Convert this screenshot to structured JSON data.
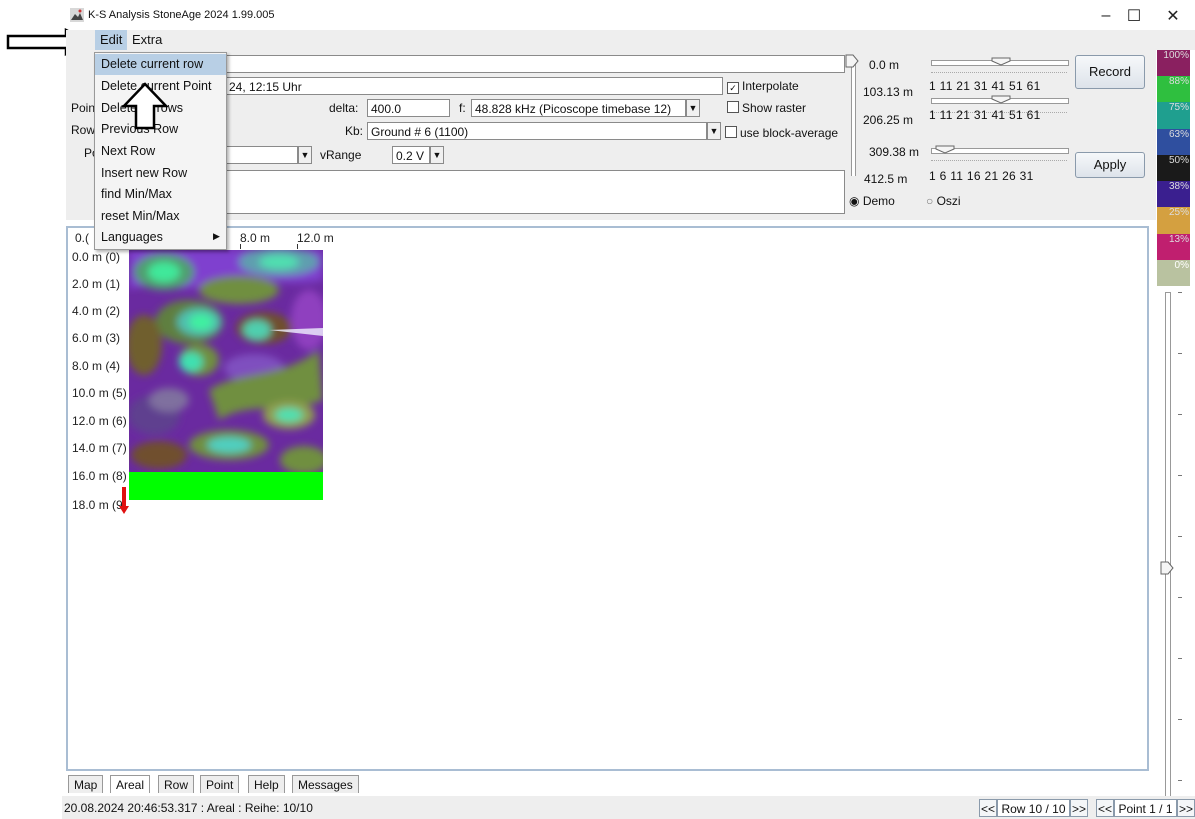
{
  "window": {
    "title": "K-S Analysis StoneAge 2024 1.99.005",
    "minimize": "–",
    "maximize": "☐",
    "close": "✕"
  },
  "menubar": {
    "items": [
      "Edit",
      "Extra"
    ]
  },
  "edit_menu": {
    "items": [
      {
        "label": "Delete current row",
        "selected": true
      },
      {
        "label": "Delete current Point"
      },
      {
        "label": "Delete all rows"
      },
      {
        "label": "Previous Row"
      },
      {
        "label": "Next Row"
      },
      {
        "label": "Insert new Row"
      },
      {
        "label": "find Min/Max"
      },
      {
        "label": "reset Min/Max"
      },
      {
        "label": "Languages",
        "submenu": true
      }
    ]
  },
  "form": {
    "date_field": "24, 12:15 Uhr",
    "left_labels": [
      "Poin",
      "Row",
      "Po"
    ],
    "delta_label": "delta:",
    "delta_value": "400.0",
    "f_label": "f:",
    "f_value": "48.828 kHz (Picoscope timebase 12)",
    "kb_label": "Kb:",
    "kb_value": "Ground # 6 (1100)",
    "vrange_label": "vRange",
    "vrange_value": "0.2 V",
    "interpolate_label": "Interpolate",
    "interpolate_checked": true,
    "show_raster_label": "Show raster",
    "show_raster_checked": false,
    "block_average_label": "use block-average",
    "block_average_checked": false,
    "demo_label": "Demo",
    "oszi_label": "Oszi",
    "mode_selected": "Demo"
  },
  "depth_scale": {
    "labels": [
      "0.0 m",
      "103.13 m",
      "206.25 m",
      "309.38 m",
      "412.5 m"
    ]
  },
  "sliders": {
    "tick_rows": [
      "1   11   21   31   41   51   61",
      "1   11   21   31   41   51   61",
      "1    6   11   16   21   26   31"
    ]
  },
  "buttons": {
    "record": "Record",
    "apply": "Apply"
  },
  "legend": {
    "labels": [
      "100%",
      "88%",
      "75%",
      "63%",
      "50%",
      "38%",
      "25%",
      "13%",
      "0%"
    ],
    "colors": [
      "#8a2060",
      "#2fbf3f",
      "#1f9f8f",
      "#2f4f9f",
      "#1a1a1a",
      "#3a1f8f",
      "#d4a040",
      "#c01f6f",
      "#b9c2a0"
    ]
  },
  "areal": {
    "x_labels": [
      "0.(",
      "8.0 m",
      "12.0 m"
    ],
    "y_labels": [
      "0.0 m (0)",
      "2.0 m (1)",
      "4.0 m (2)",
      "6.0 m (3)",
      "8.0 m (4)",
      "10.0 m (5)",
      "12.0 m (6)",
      "14.0 m (7)",
      "16.0 m (8)",
      "18.0 m (9)"
    ]
  },
  "tabs": [
    "Map",
    "Areal",
    "Row",
    "Point",
    "Help",
    "Messages"
  ],
  "active_tab": "Areal",
  "status": {
    "text": "20.08.2024 20:46:53.317 : Areal : Reihe: 10/10",
    "row_prev": "<<",
    "row_label": "Row 10 / 10",
    "row_next": ">>",
    "point_prev": "<<",
    "point_label": "Point 1 / 1",
    "point_next": ">>"
  }
}
